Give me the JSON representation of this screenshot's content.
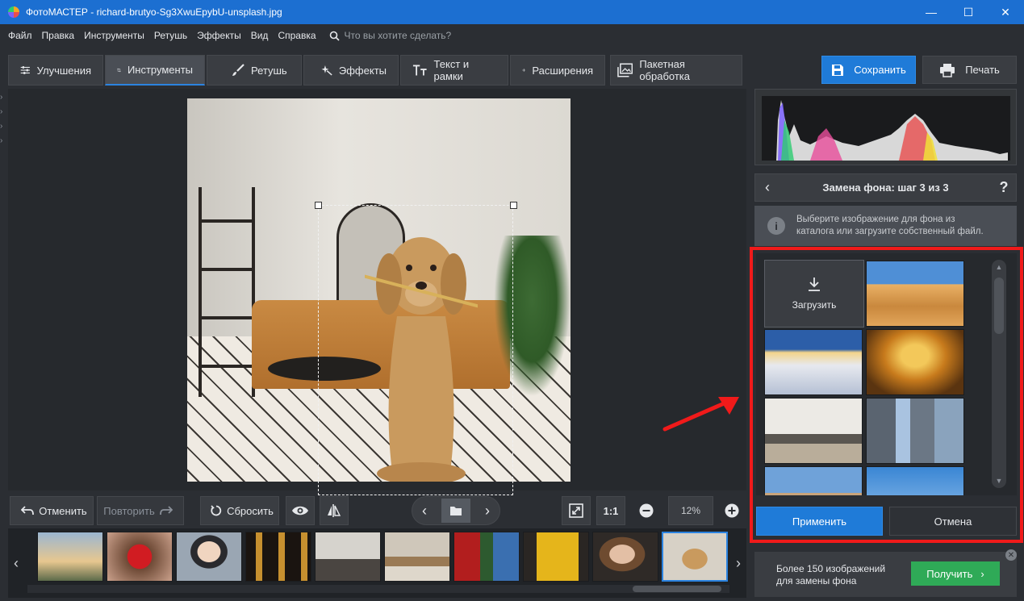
{
  "window": {
    "title": "ФотоМАСТЕР - richard-brutyo-Sg3XwuEpybU-unsplash.jpg",
    "minimize": "—",
    "maximize": "☐",
    "close": "✕"
  },
  "menu": {
    "items": [
      "Файл",
      "Правка",
      "Инструменты",
      "Ретушь",
      "Эффекты",
      "Вид",
      "Справка"
    ],
    "search_placeholder": "Что вы хотите сделать?"
  },
  "tabs": [
    {
      "label": "Улучшения",
      "icon": "sliders-icon",
      "active": false
    },
    {
      "label": "Инструменты",
      "icon": "crop-icon",
      "active": true
    },
    {
      "label": "Ретушь",
      "icon": "brush-icon",
      "active": false
    },
    {
      "label": "Эффекты",
      "icon": "sparkle-icon",
      "active": false
    },
    {
      "label": "Текст и рамки",
      "icon": "text-icon",
      "active": false
    },
    {
      "label": "Расширения",
      "icon": "plus-icon",
      "active": false
    },
    {
      "label": "Пакетная обработка",
      "icon": "images-icon",
      "active": false
    }
  ],
  "actions": {
    "save": "Сохранить",
    "print": "Печать"
  },
  "toolbar": {
    "undo": "Отменить",
    "redo": "Повторить",
    "reset": "Сбросить",
    "one_to_one": "1:1",
    "zoom": "12%"
  },
  "panel": {
    "step_title": "Замена фона: шаг 3 из 3",
    "help": "?",
    "info_line1": "Выберите изображение для фона из",
    "info_line2": "каталога или загрузите собственный файл.",
    "upload_label": "Загрузить",
    "apply": "Применить",
    "cancel": "Отмена"
  },
  "promo": {
    "line1": "Более 150 изображений",
    "line2": "для замены фона",
    "button": "Получить"
  },
  "colors": {
    "titlebar": "#1c6fd1",
    "accent": "#1f7bd8",
    "highlight": "#f01a1a",
    "buy": "#2faa57"
  }
}
